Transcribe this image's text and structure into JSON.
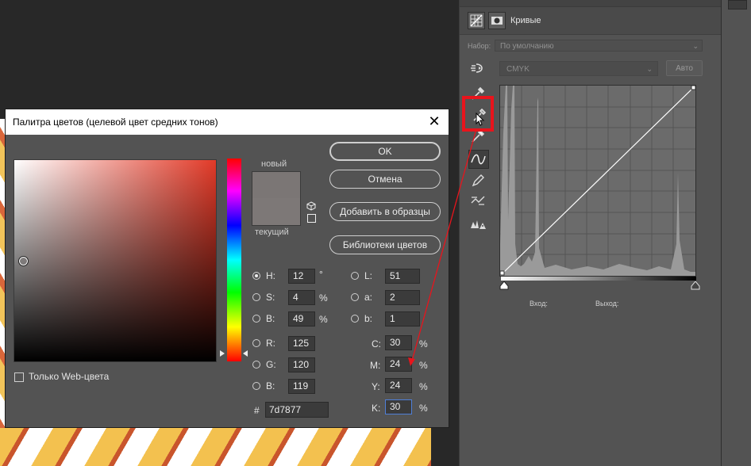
{
  "panel": {
    "title": "Кривые",
    "preset_label": "Набор:",
    "preset_value": "По умолчанию",
    "channel_value": "CMYK",
    "auto_label": "Авто",
    "input_label": "Вход:",
    "output_label": "Выход:",
    "tools": [
      "sample-black-icon",
      "sample-gray-icon",
      "sample-white-icon",
      "curve-icon",
      "pencil-icon",
      "smooth-icon",
      "clipping-warning-icon"
    ]
  },
  "dialog": {
    "title": "Палитра цветов (целевой цвет средних тонов)",
    "close": "✕",
    "new_label": "новый",
    "current_label": "текущий",
    "ok": "OK",
    "cancel": "Отмена",
    "add_swatches": "Добавить в образцы",
    "libraries": "Библиотеки цветов",
    "websafe_label": "Только Web-цвета",
    "hex_label": "#",
    "hex_value": "7d7877",
    "hsb": {
      "h_label": "H:",
      "h_value": "12",
      "h_unit": "°",
      "s_label": "S:",
      "s_value": "4",
      "s_unit": "%",
      "b_label": "B:",
      "b_value": "49",
      "b_unit": "%"
    },
    "rgb": {
      "r_label": "R:",
      "r_value": "125",
      "g_label": "G:",
      "g_value": "120",
      "b_label": "B:",
      "b_value": "119"
    },
    "lab": {
      "l_label": "L:",
      "l_value": "51",
      "a_label": "a:",
      "a_value": "2",
      "b_label": "b:",
      "b_value": "1"
    },
    "cmyk": {
      "c_label": "C:",
      "c_value": "30",
      "c_unit": "%",
      "m_label": "M:",
      "m_value": "24",
      "m_unit": "%",
      "y_label": "Y:",
      "y_value": "24",
      "y_unit": "%",
      "k_label": "K:",
      "k_value": "30",
      "k_unit": "%"
    },
    "colors": {
      "new": "#7b7675",
      "current": "#7d7877",
      "field_hue": "#e23a28"
    }
  },
  "annotation": {
    "highlight_color": "#e8141c"
  }
}
